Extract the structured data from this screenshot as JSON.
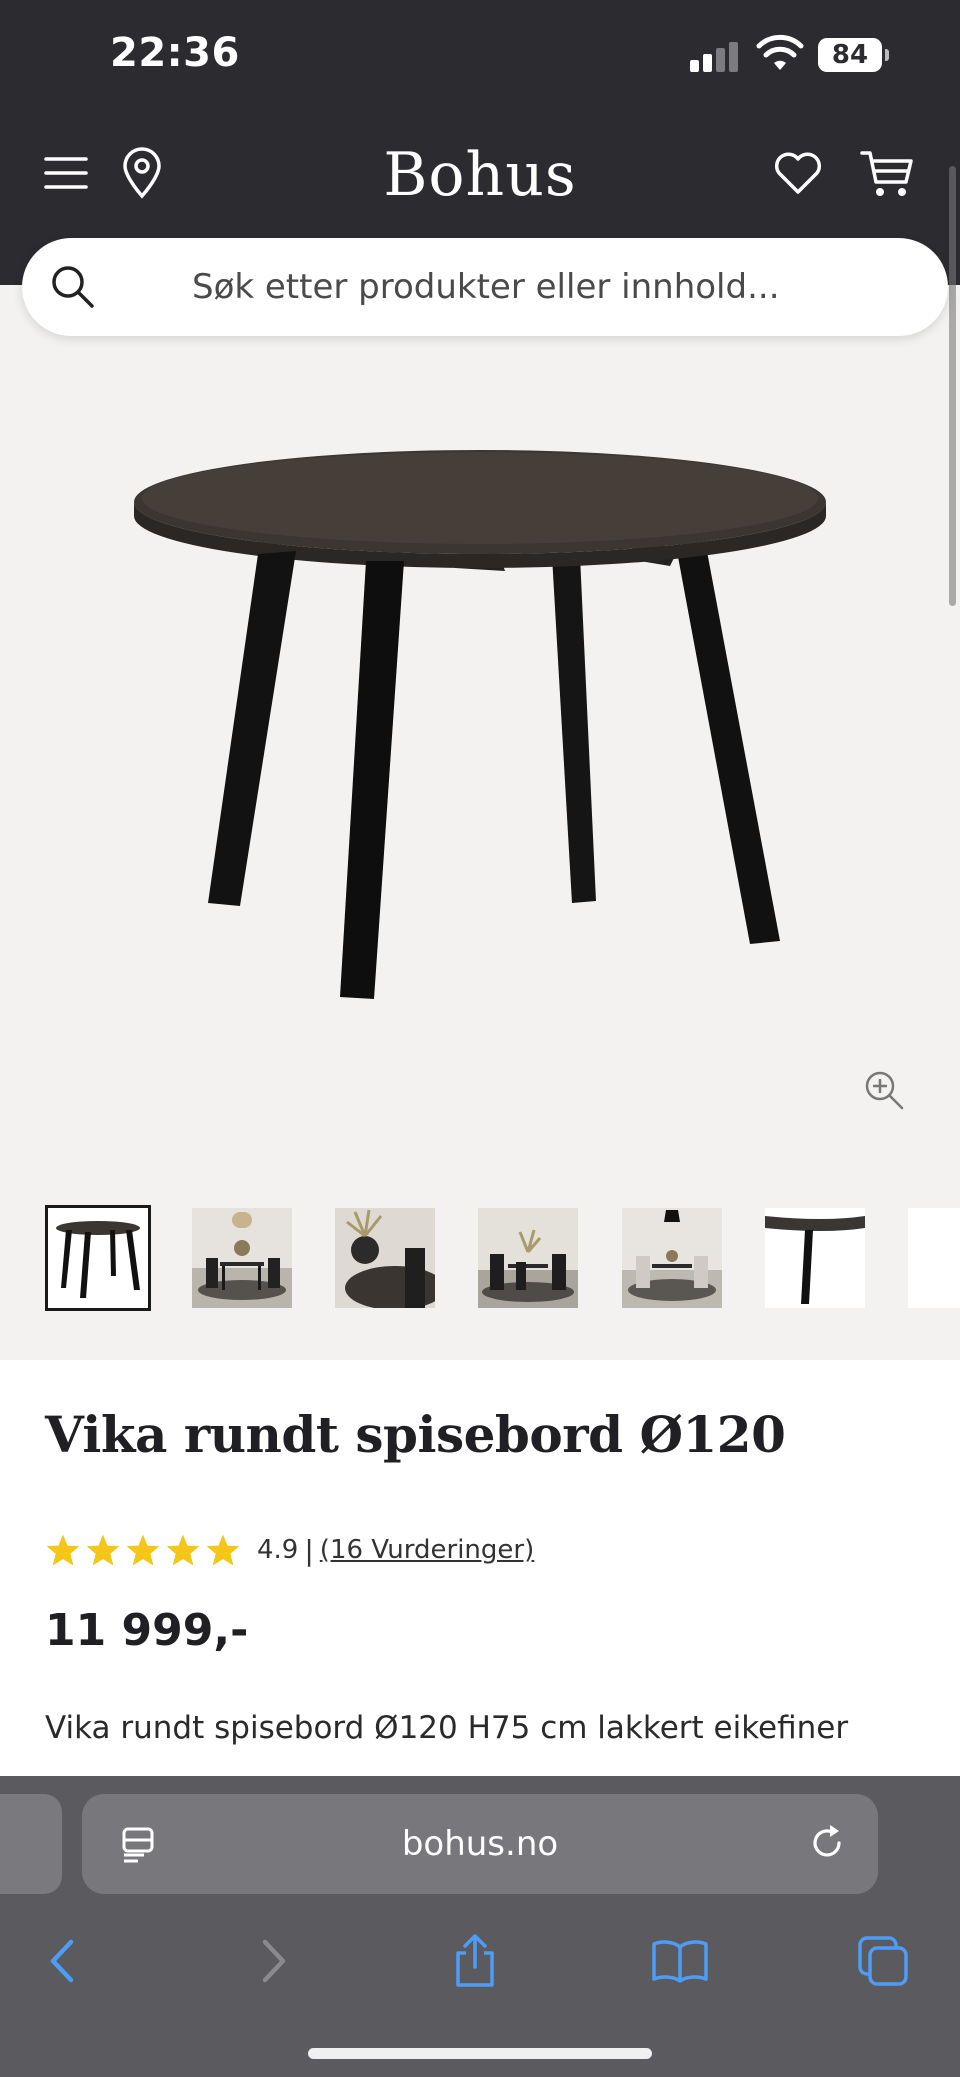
{
  "status_bar": {
    "time": "22:36",
    "battery": "84",
    "icons": [
      "signal-icon",
      "wifi-icon",
      "battery-icon"
    ]
  },
  "header": {
    "logo": "Bohus",
    "icons": [
      "menu-icon",
      "location-pin-icon",
      "heart-icon",
      "cart-icon"
    ]
  },
  "search": {
    "placeholder": "Søk etter produkter eller innhold..."
  },
  "gallery": {
    "thumbnails": [
      "thumbnail-1",
      "thumbnail-2",
      "thumbnail-3",
      "thumbnail-4",
      "thumbnail-5",
      "thumbnail-6",
      "thumbnail-7"
    ],
    "selected_index": 0
  },
  "product": {
    "title": "Vika rundt spisebord Ø120",
    "rating_stars": 5,
    "rating_value": "4.9",
    "separator": "|",
    "reviews": "(16 Vurderinger)",
    "price": "11 999,-",
    "description": "Vika rundt spisebord Ø120 H75 cm lakkert eikefiner"
  },
  "browser": {
    "url": "bohus.no",
    "toolbar": [
      "back-icon",
      "forward-icon",
      "share-icon",
      "bookmarks-icon",
      "tabs-icon"
    ]
  },
  "colors": {
    "header_bg": "#2c2c30",
    "star": "#f5c518",
    "safari_bg": "#5b5b5f"
  }
}
